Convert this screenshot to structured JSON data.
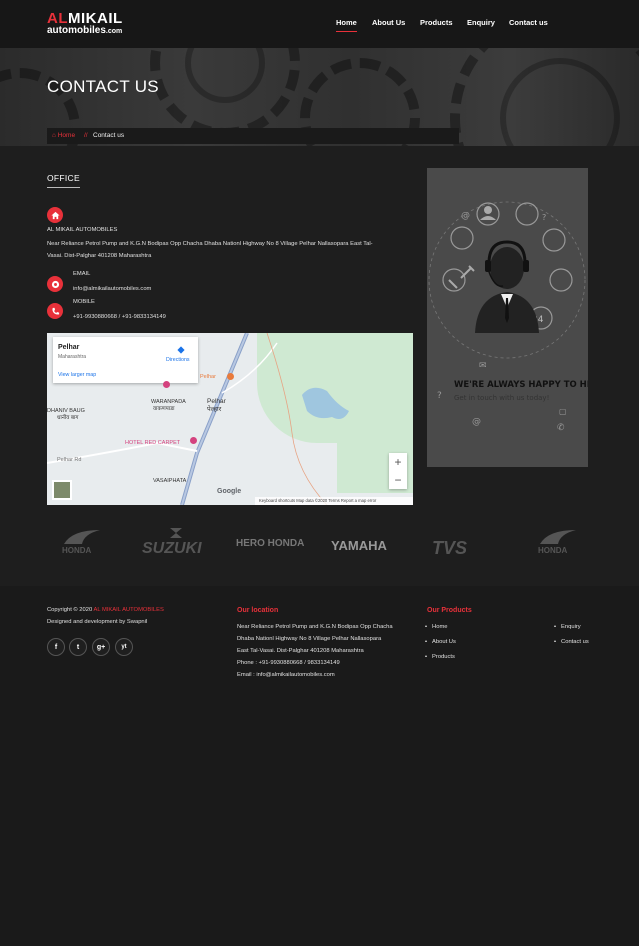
{
  "brand": {
    "name_red": "AL",
    "name_white": "MIKAIL",
    "sub": "automobiles",
    "sub_suffix": ".com"
  },
  "nav": [
    "Home",
    "About Us",
    "Products",
    "Enquiry",
    "Contact us"
  ],
  "banner": {
    "title": "CONTACT US",
    "breadcrumb_home": "Home",
    "breadcrumb_sep": "//",
    "breadcrumb_current": "Contact us"
  },
  "office": {
    "title": "OFFICE",
    "company": "AL MIKAIL AUTOMOBILES",
    "address_line1": "Near Reliance Petrol Pump and K.G.N Bodipas Opp Chacha Dhaba Nationl Highway No 8 Village Pelhar Nallasopara East Tal-",
    "address_line2": "Vasai. Dist-Palghar 401208 Maharashtra",
    "email_label": "EMAIL",
    "email": "info@almikailautomobiles.com",
    "mobile_label": "MOBILE",
    "mobile": "+91-9930880668 / +91-9833134149"
  },
  "map": {
    "place": "Pelhar",
    "region": "Maharashtra",
    "directions": "Directions",
    "larger": "View larger map",
    "labels": [
      "Pelhar",
      "WARANPADA",
      "वाकणपाडा",
      "Pelhar",
      "पेल्हार",
      "DHANIV BAUG",
      "धानीव बाग",
      "HOTEL RED CARPET",
      "VASAIPHATA",
      "Pelhar Rd"
    ],
    "footer": "Keyboard shortcuts   Map data ©2020   Terms   Report a map error",
    "google": "Google"
  },
  "support": {
    "line1": "WE'RE ALWAYS HAPPY TO HELP",
    "line2": "Get in touch with us today!"
  },
  "brands": [
    "HONDA",
    "SUZUKI",
    "HERO HONDA",
    "YAMAHA",
    "TVS",
    "HONDA"
  ],
  "footer": {
    "copyright_prefix": "Copyright © 2020",
    "copyright_brand": "AL MIKAIL AUTOMOBILES",
    "designed": "Designed and development by Swapnil",
    "social": [
      "f",
      "t",
      "g+",
      "yt"
    ],
    "location_title": "Our location",
    "location_lines": [
      "Near Reliance Petrol Pump and K.G.N Bodipas Opp Chacha",
      "Dhaba Nationl Highway No 8 Village Pelhar Nallasopara",
      "East Tal-Vasai. Dist-Palghar 401208 Maharashtra",
      "Phone : +91-9930880668 / 9833134149",
      "Email : info@almikailautomobiles.com"
    ],
    "products_title": "Our Products",
    "links_left": [
      "Home",
      "About Us",
      "Products"
    ],
    "links_right": [
      "Enquiry",
      "Contact us"
    ]
  },
  "colors": {
    "accent": "#e8313a",
    "bg": "#1e1e1e",
    "footer": "#1a1a1a"
  }
}
